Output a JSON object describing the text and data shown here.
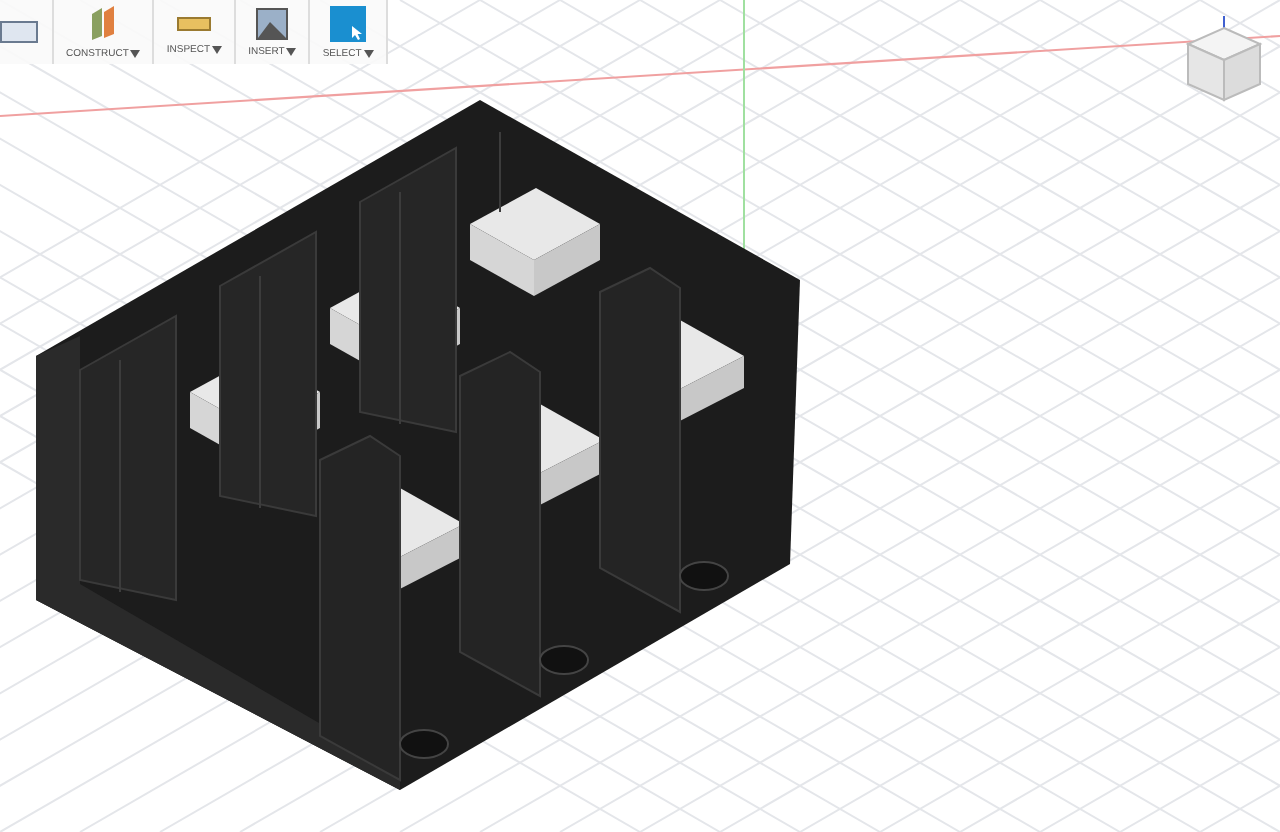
{
  "toolbar": {
    "groups": [
      {
        "kind": "solid"
      },
      {
        "kind": "construct",
        "label": "CONSTRUCT"
      },
      {
        "kind": "inspect",
        "label": "INSPECT"
      },
      {
        "kind": "insert",
        "label": "INSERT"
      },
      {
        "kind": "select",
        "label": "SELECT"
      }
    ]
  }
}
